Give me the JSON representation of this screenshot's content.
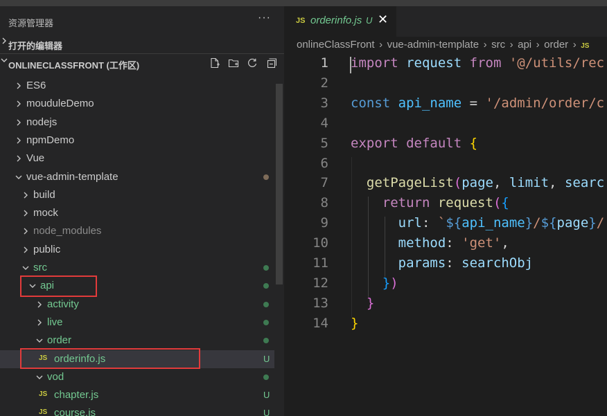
{
  "explorer": {
    "title": "资源管理器",
    "more": "···",
    "open_editors_label": "打开的编辑器",
    "workspace_label": "ONLINECLASSFRONT (工作区)",
    "action_icons": [
      "new-file-icon",
      "new-folder-icon",
      "refresh-icon",
      "collapse-all-icon"
    ],
    "tree": [
      {
        "label": "ES6",
        "kind": "folder",
        "expanded": false,
        "status": ""
      },
      {
        "label": "mouduleDemo",
        "kind": "folder",
        "expanded": false,
        "status": ""
      },
      {
        "label": "nodejs",
        "kind": "folder",
        "expanded": false,
        "status": ""
      },
      {
        "label": "npmDemo",
        "kind": "folder",
        "expanded": false,
        "status": ""
      },
      {
        "label": "Vue",
        "kind": "folder",
        "expanded": false,
        "status": ""
      },
      {
        "label": "vue-admin-template",
        "kind": "folder",
        "expanded": true,
        "status": "modified-dot"
      },
      {
        "label": "build",
        "kind": "folder",
        "expanded": false,
        "status": ""
      },
      {
        "label": "mock",
        "kind": "folder",
        "expanded": false,
        "status": ""
      },
      {
        "label": "node_modules",
        "kind": "folder",
        "expanded": false,
        "status": ""
      },
      {
        "label": "public",
        "kind": "folder",
        "expanded": false,
        "status": ""
      },
      {
        "label": "src",
        "kind": "folder",
        "expanded": true,
        "status": "untracked-dot"
      },
      {
        "label": "api",
        "kind": "folder",
        "expanded": true,
        "status": "untracked-dot"
      },
      {
        "label": "activity",
        "kind": "folder",
        "expanded": false,
        "status": "untracked-dot"
      },
      {
        "label": "live",
        "kind": "folder",
        "expanded": false,
        "status": "untracked-dot"
      },
      {
        "label": "order",
        "kind": "folder",
        "expanded": true,
        "status": "untracked-dot"
      },
      {
        "label": "orderinfo.js",
        "kind": "file",
        "badge": "JS",
        "status": "U"
      },
      {
        "label": "vod",
        "kind": "folder",
        "expanded": true,
        "status": "untracked-dot"
      },
      {
        "label": "chapter.js",
        "kind": "file",
        "badge": "JS",
        "status": "U"
      },
      {
        "label": "course.js",
        "kind": "file",
        "badge": "JS",
        "status": "U"
      }
    ]
  },
  "editor": {
    "tab": {
      "badge": "JS",
      "title": "orderinfo.js",
      "status": "U",
      "close": "✕"
    },
    "breadcrumb": [
      "onlineClassFront",
      "vue-admin-template",
      "src",
      "api",
      "order",
      "JS"
    ],
    "code": [
      {
        "n": "1",
        "tokens": [
          [
            "kw",
            "import"
          ],
          [
            "plain",
            " "
          ],
          [
            "var",
            "request"
          ],
          [
            "plain",
            " "
          ],
          [
            "kw",
            "from"
          ],
          [
            "plain",
            " "
          ],
          [
            "str",
            "'@/utils/rec"
          ]
        ]
      },
      {
        "n": "2",
        "tokens": []
      },
      {
        "n": "3",
        "tokens": [
          [
            "blue",
            "const"
          ],
          [
            "plain",
            " "
          ],
          [
            "const",
            "api_name"
          ],
          [
            "plain",
            " = "
          ],
          [
            "str",
            "'/admin/order/c"
          ]
        ]
      },
      {
        "n": "4",
        "tokens": []
      },
      {
        "n": "5",
        "tokens": [
          [
            "kw",
            "export"
          ],
          [
            "plain",
            " "
          ],
          [
            "kw",
            "default"
          ],
          [
            "plain",
            " "
          ],
          [
            "b1",
            "{"
          ]
        ]
      },
      {
        "n": "6",
        "tokens": []
      },
      {
        "n": "7",
        "tokens": [
          [
            "plain",
            "  "
          ],
          [
            "fn",
            "getPageList"
          ],
          [
            "b2",
            "("
          ],
          [
            "var",
            "page"
          ],
          [
            "plain",
            ", "
          ],
          [
            "var",
            "limit"
          ],
          [
            "plain",
            ", "
          ],
          [
            "var",
            "searc"
          ]
        ]
      },
      {
        "n": "8",
        "tokens": [
          [
            "plain",
            "    "
          ],
          [
            "kw",
            "return"
          ],
          [
            "plain",
            " "
          ],
          [
            "fn",
            "request"
          ],
          [
            "b2",
            "("
          ],
          [
            "b3",
            "{"
          ]
        ]
      },
      {
        "n": "9",
        "tokens": [
          [
            "plain",
            "      "
          ],
          [
            "var",
            "url"
          ],
          [
            "plain",
            ": "
          ],
          [
            "str",
            "`"
          ],
          [
            "blue",
            "${"
          ],
          [
            "const",
            "api_name"
          ],
          [
            "blue",
            "}"
          ],
          [
            "str",
            "/"
          ],
          [
            "blue",
            "${"
          ],
          [
            "var",
            "page"
          ],
          [
            "blue",
            "}"
          ],
          [
            "str",
            "/"
          ]
        ]
      },
      {
        "n": "10",
        "tokens": [
          [
            "plain",
            "      "
          ],
          [
            "var",
            "method"
          ],
          [
            "plain",
            ": "
          ],
          [
            "str",
            "'get'"
          ],
          [
            "plain",
            ","
          ]
        ]
      },
      {
        "n": "11",
        "tokens": [
          [
            "plain",
            "      "
          ],
          [
            "var",
            "params"
          ],
          [
            "plain",
            ": "
          ],
          [
            "var",
            "searchObj"
          ]
        ]
      },
      {
        "n": "12",
        "tokens": [
          [
            "plain",
            "    "
          ],
          [
            "b3",
            "}"
          ],
          [
            "b2",
            ")"
          ]
        ]
      },
      {
        "n": "13",
        "tokens": [
          [
            "plain",
            "  "
          ],
          [
            "b2",
            "}"
          ]
        ]
      },
      {
        "n": "14",
        "tokens": [
          [
            "b1",
            "}"
          ]
        ]
      }
    ]
  },
  "colors": {
    "untracked": "#73c991",
    "modified_dot": "#7d6b58",
    "highlight_box": "#e23b3b",
    "js_badge": "#cbcb41"
  }
}
